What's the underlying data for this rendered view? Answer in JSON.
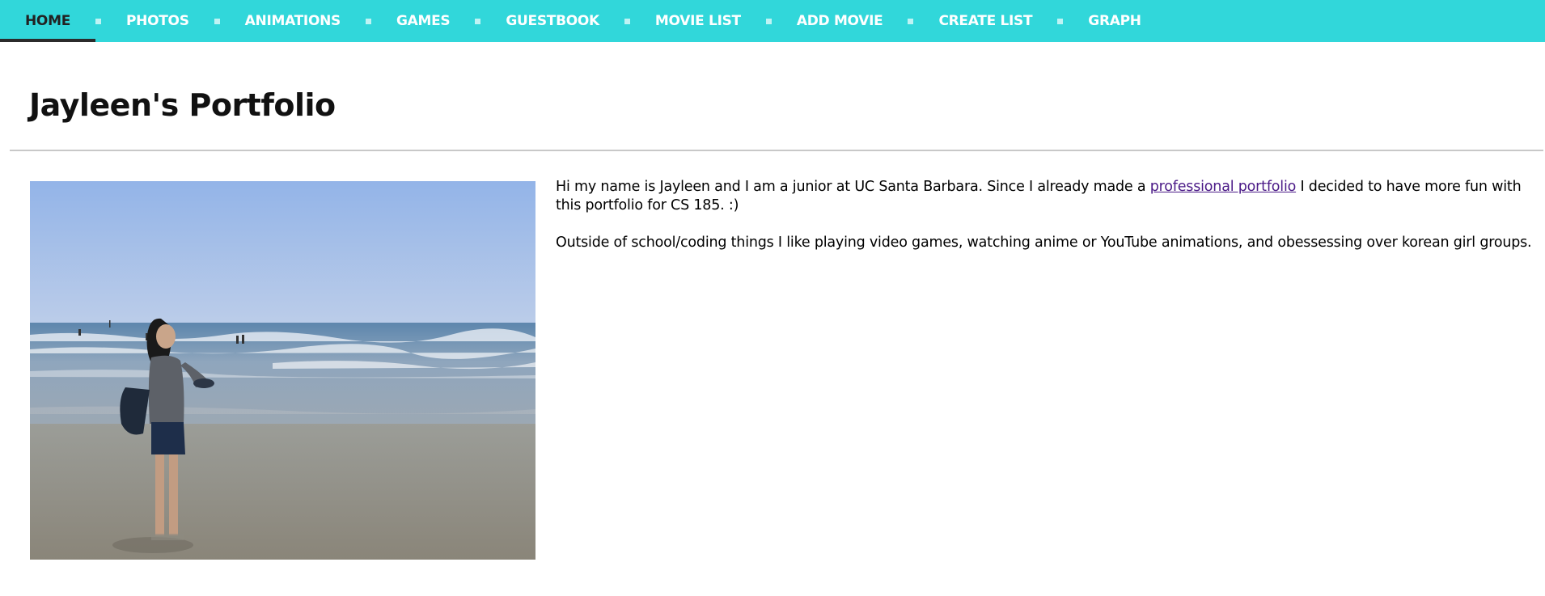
{
  "nav": {
    "items": [
      {
        "label": "HOME",
        "active": true
      },
      {
        "label": "PHOTOS",
        "active": false
      },
      {
        "label": "ANIMATIONS",
        "active": false
      },
      {
        "label": "GAMES",
        "active": false
      },
      {
        "label": "GUESTBOOK",
        "active": false
      },
      {
        "label": "MOVIE LIST",
        "active": false
      },
      {
        "label": "ADD MOVIE",
        "active": false
      },
      {
        "label": "CREATE LIST",
        "active": false
      },
      {
        "label": "GRAPH",
        "active": false
      }
    ],
    "colors": {
      "background": "#31d7da",
      "text": "#ffffff",
      "active_text": "#222222",
      "separator": "#bff3f4"
    }
  },
  "main": {
    "title": "Jayleen's Portfolio",
    "intro": {
      "p1_before_link": "Hi my name is Jayleen and I am a junior at UC Santa Barbara. Since I already made a ",
      "p1_link": "professional portfolio",
      "p1_after_link": " I decided to have more fun with this portfolio for CS 185. :)",
      "p2": "Outside of school/coding things I like playing video games, watching anime or YouTube animations, and obessessing over korean girl groups."
    },
    "link_color": "#4b1a87"
  }
}
